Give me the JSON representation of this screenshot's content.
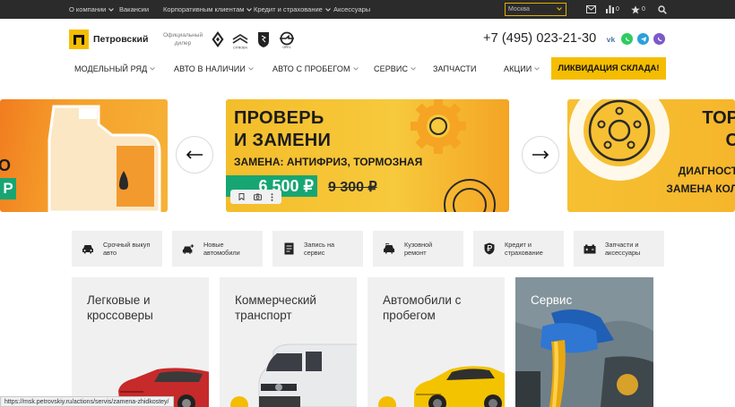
{
  "topbar": {
    "links": [
      "О компании",
      "Вакансии",
      "Корпоративным клиентам",
      "Кредит и страхование",
      "Аксессуары"
    ],
    "city": "Москва",
    "compare_count": "0",
    "favorites_count": "0"
  },
  "header": {
    "logo_letter": "П",
    "logo_name": "Петровский",
    "dealer_text": "Официальный дилер",
    "brands": [
      "Renault",
      "Citroën",
      "Peugeot",
      "Opel"
    ],
    "phone": "+7 (495) 023-21-30",
    "socials": [
      "vk",
      "whatsapp",
      "telegram",
      "viber"
    ]
  },
  "nav": {
    "items": [
      "МОДЕЛЬНЫЙ РЯД",
      "АВТО В НАЛИЧИИ",
      "АВТО С ПРОБЕГОМ",
      "СЕРВИС",
      "ЗАПЧАСТИ",
      "АКЦИИ"
    ],
    "highlight": "ЛИКВИДАЦИЯ СКЛАДА!"
  },
  "slider": {
    "left": {
      "title": "О",
      "price": "Р"
    },
    "center": {
      "title_line1": "ПРОВЕРЬ",
      "title_line2": "И ЗАМЕНИ",
      "subtitle": "ЗАМЕНА: АНТИФРИЗ, ТОРМОЗНАЯ",
      "price": "6 500 ₽",
      "old_price": "9 300 ₽"
    },
    "right": {
      "title_line1": "ТОР",
      "title_line2": "С",
      "sub_line1": "ДИАГНОСТ",
      "sub_line2": "ЗАМЕНА КОЛ"
    }
  },
  "quick_links": [
    {
      "icon": "car-icon",
      "label": "Срочный выкуп авто"
    },
    {
      "icon": "car-plus-icon",
      "label": "Новые автомобили"
    },
    {
      "icon": "document-icon",
      "label": "Запись на сервис"
    },
    {
      "icon": "car-repair-icon",
      "label": "Кузовной ремонт"
    },
    {
      "icon": "ruble-shield-icon",
      "label": "Кредит и страхование"
    },
    {
      "icon": "battery-icon",
      "label": "Запчасти и аксессуары"
    }
  ],
  "categories": [
    "Легковые и кроссоверы",
    "Коммерческий транспорт",
    "Автомобили с пробегом",
    "Сервис"
  ],
  "status_url": "https://msk.petrovskiy.ru/actions/servis/zamena-zhidkostey/",
  "colors": {
    "accent": "#f5bd00",
    "topbar": "#2b2b2b",
    "price_green": "#17a673"
  }
}
